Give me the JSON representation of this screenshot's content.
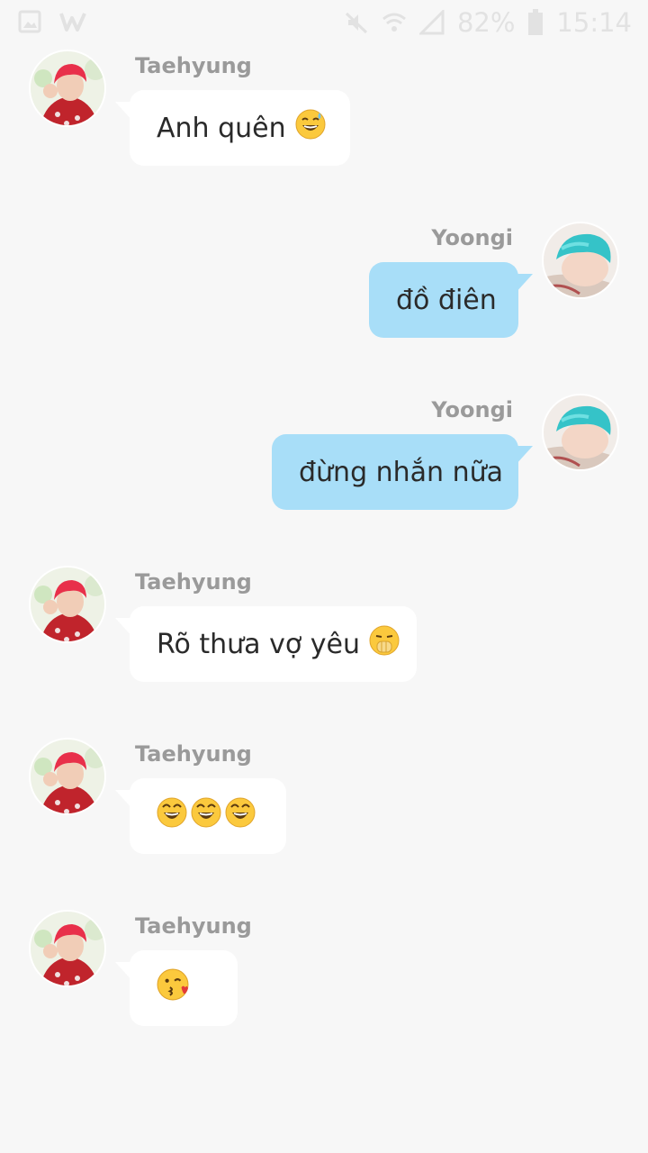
{
  "status_bar": {
    "battery": "82%",
    "time": "15:14",
    "icons": [
      "image-icon",
      "app-logo-icon",
      "mute-icon",
      "wifi-icon",
      "signal-icon",
      "battery-icon"
    ]
  },
  "colors": {
    "background": "#f7f7f7",
    "incoming_bubble": "#ffffff",
    "outgoing_bubble": "#a8def8",
    "sender_name": "#9a9a9a"
  },
  "messages": [
    {
      "sender": "Taehyung",
      "side": "left",
      "text": "Anh quên",
      "emojis": [
        "grinning-sweat-emoji"
      ]
    },
    {
      "sender": "Yoongi",
      "side": "right",
      "text": "đồ điên",
      "emojis": []
    },
    {
      "sender": "Yoongi",
      "side": "right",
      "text": "đừng nhắn nữa",
      "emojis": []
    },
    {
      "sender": "Taehyung",
      "side": "left",
      "text": "Rõ thưa vợ yêu",
      "emojis": [
        "covering-mouth-emoji"
      ]
    },
    {
      "sender": "Taehyung",
      "side": "left",
      "text": "",
      "emojis": [
        "laughing-emoji",
        "laughing-emoji",
        "laughing-emoji"
      ]
    },
    {
      "sender": "Taehyung",
      "side": "left",
      "text": "",
      "emojis": [
        "kissing-heart-emoji"
      ]
    }
  ]
}
